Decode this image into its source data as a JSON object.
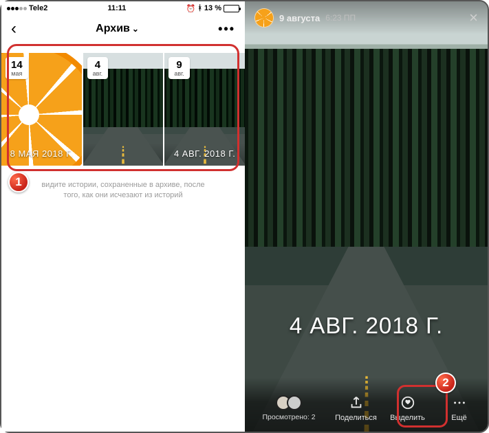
{
  "left": {
    "status": {
      "carrier": "Tele2",
      "time": "11:11",
      "battery_pct": "13 %"
    },
    "nav": {
      "title": "Архив"
    },
    "thumbs": [
      {
        "day": "14",
        "month": "мая",
        "overlay": "8 МАЯ 2018 Г."
      },
      {
        "day": "4",
        "month": "авг.",
        "overlay": ""
      },
      {
        "day": "9",
        "month": "авг.",
        "overlay": "4 АВГ. 2018 Г."
      }
    ],
    "note_line1": "видите истории, сохраненные в архиве, после",
    "note_line2": "того, как они исчезают из историй"
  },
  "right": {
    "header": {
      "username": "9 августа",
      "time": "6:23 ПП"
    },
    "big_date": "4 АВГ. 2018 Г.",
    "viewers_label": "Просмотрено: 2",
    "share_label": "Поделиться",
    "highlight_label": "Выделить",
    "more_label": "Ещё"
  },
  "annotations": {
    "badge1": "1",
    "badge2": "2"
  }
}
